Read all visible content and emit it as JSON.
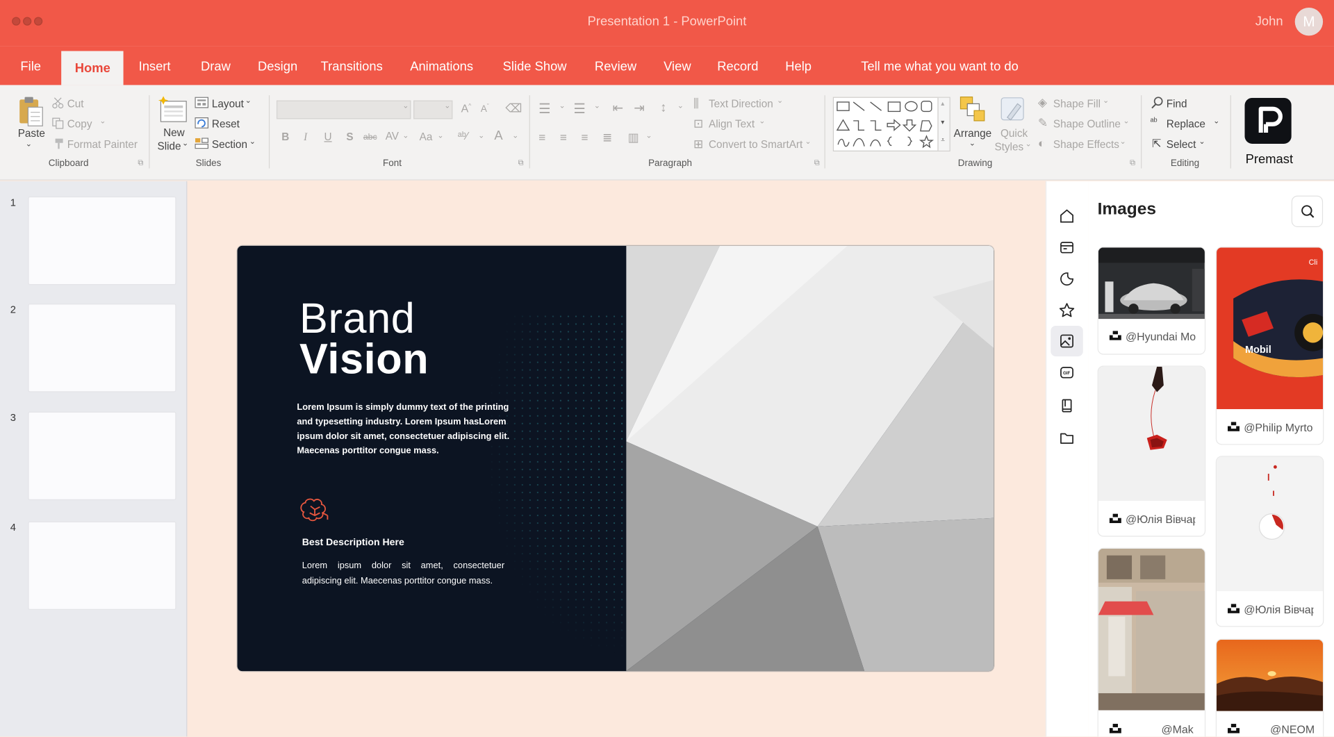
{
  "window": {
    "title": "Presentation 1 - PowerPoint",
    "user": "John",
    "avatar_initial": "M"
  },
  "tabs": [
    "File",
    "Home",
    "Insert",
    "Draw",
    "Design",
    "Transitions",
    "Animations",
    "Slide Show",
    "Review",
    "View",
    "Record",
    "Help"
  ],
  "active_tab": "Home",
  "tell_me": "Tell me what you want to do",
  "ribbon": {
    "clipboard": {
      "paste": "Paste",
      "cut": "Cut",
      "copy": "Copy",
      "format_painter": "Format Painter",
      "group": "Clipboard"
    },
    "slides": {
      "new_slide_1": "New",
      "new_slide_2": "Slide",
      "layout": "Layout",
      "reset": "Reset",
      "section": "Section",
      "group": "Slides"
    },
    "font": {
      "group": "Font",
      "bold": "B",
      "italic": "I",
      "underline": "U",
      "strike": "S",
      "abc": "abc",
      "spacing": "AV",
      "case": "Aa"
    },
    "paragraph": {
      "text_direction": "Text Direction",
      "align_text": "Align Text",
      "smartart": "Convert to SmartArt",
      "group": "Paragraph"
    },
    "drawing": {
      "arrange": "Arrange",
      "quick_styles_1": "Quick",
      "quick_styles_2": "Styles",
      "shape_fill": "Shape Fill",
      "shape_outline": "Shape Outline",
      "shape_effects": "Shape Effects",
      "group": "Drawing"
    },
    "editing": {
      "find": "Find",
      "replace": "Replace",
      "select": "Select",
      "group": "Editing"
    },
    "addin": {
      "label": "Premast"
    }
  },
  "slides_panel": {
    "numbers": [
      "1",
      "2",
      "3",
      "4"
    ]
  },
  "slide": {
    "title_line1": "Brand",
    "title_line2": "Vision",
    "body": "Lorem Ipsum is simply dummy text of the printing and typesetting industry. Lorem Ipsum hasLorem ipsum dolor sit amet, consectetuer adipiscing elit. Maecenas porttitor congue mass.",
    "subheading": "Best Description Here",
    "body2": "Lorem ipsum dolor sit amet, consectetuer adipiscing elit. Maecenas porttitor congue mass.",
    "accent": "#e7573f"
  },
  "images_panel": {
    "title": "Images",
    "items": [
      {
        "caption": "@Hyundai Mo"
      },
      {
        "caption": "@Юлія Вівчар"
      },
      {
        "caption": "@Mak"
      },
      {
        "caption": "@Philip Myrto"
      },
      {
        "caption": "@Юлія Вівчар"
      },
      {
        "caption": "@NEOM"
      }
    ]
  },
  "colors": {
    "titlebar": "#f15848",
    "ribbon": "#f3f2f1",
    "canvas": "#fce9dd",
    "slide_dark": "#0c1422"
  }
}
